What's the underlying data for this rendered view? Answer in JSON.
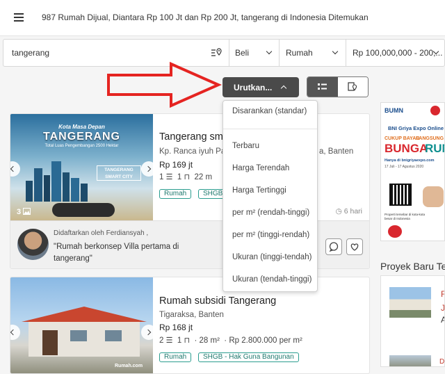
{
  "header": {
    "title": "987 Rumah Dijual, Diantara Rp 100 Jt dan Rp 200 Jt, tangerang di Indonesia Ditemukan"
  },
  "search": {
    "location_value": "tangerang",
    "transaction": "Beli",
    "property_type": "Rumah",
    "price_range": "Rp 100,000,000 - 200,..."
  },
  "sort": {
    "button_label": "Urutkan...",
    "options": [
      "Disarankan (standar)",
      "Terbaru",
      "Harga Terendah",
      "Harga Tertinggi",
      "per m² (rendah-tinggi)",
      "per m² (tinggi-rendah)",
      "Ukuran (tinggi-tendah)",
      "Ukuran (tendah-tinggi)"
    ]
  },
  "listings": [
    {
      "photo_heading": "Kota Masa Depan",
      "photo_title": "TANGERANG",
      "photo_subtitle": "Total Luas Pengembangan 2500 Hektar",
      "photo_brand": "TANGERANG SMART CITY",
      "photo_count": "3",
      "title": "Tangerang sm",
      "location": "Kp. Ranca iyuh Par",
      "location_tail": "a, Banten",
      "price": "Rp 169 jt",
      "bed": "1",
      "bath": "1",
      "area": "22 m",
      "tags": [
        "Rumah",
        "SHGB -"
      ],
      "posted": "6 hari",
      "agent_by": "Didaftarkan oleh Ferdiansyah ,",
      "agent_quote": "\"Rumah berkonsep Villa pertama di tangerang\""
    },
    {
      "title": "Rumah subsidi Tangerang",
      "location": "Tigaraksa, Banten",
      "price": "Rp 168 jt",
      "bed": "2",
      "bath": "1",
      "area": "28 m²",
      "price_per_m2": "Rp 2.800.000 per m²",
      "tags": [
        "Rumah",
        "SHGB - Hak Guna Bangunan"
      ],
      "photo_watermark": "Rumah.com"
    }
  ],
  "ad": {
    "brand": "BUMN",
    "expo": "BNI Griya Expo Online",
    "line1": "CUKUP BAYAR",
    "line2": "LANGSUNG",
    "big1": "BUNGA",
    "big2": "RUM",
    "site": "Hanya di bnigriyaexpo.com",
    "dates": "17 Juli - 17 Agustus 2020",
    "footer": "Properti tersebar di kota-kota besar di Indonesia"
  },
  "proyek": {
    "heading": "Proyek Baru Te",
    "item1_letters": "F J",
    "item1_sub": "A",
    "item2_text": "Duta"
  },
  "colors": {
    "arrow": "#e52421",
    "tag_border": "#2a9d8f",
    "sort_button": "#4a4a4a"
  }
}
